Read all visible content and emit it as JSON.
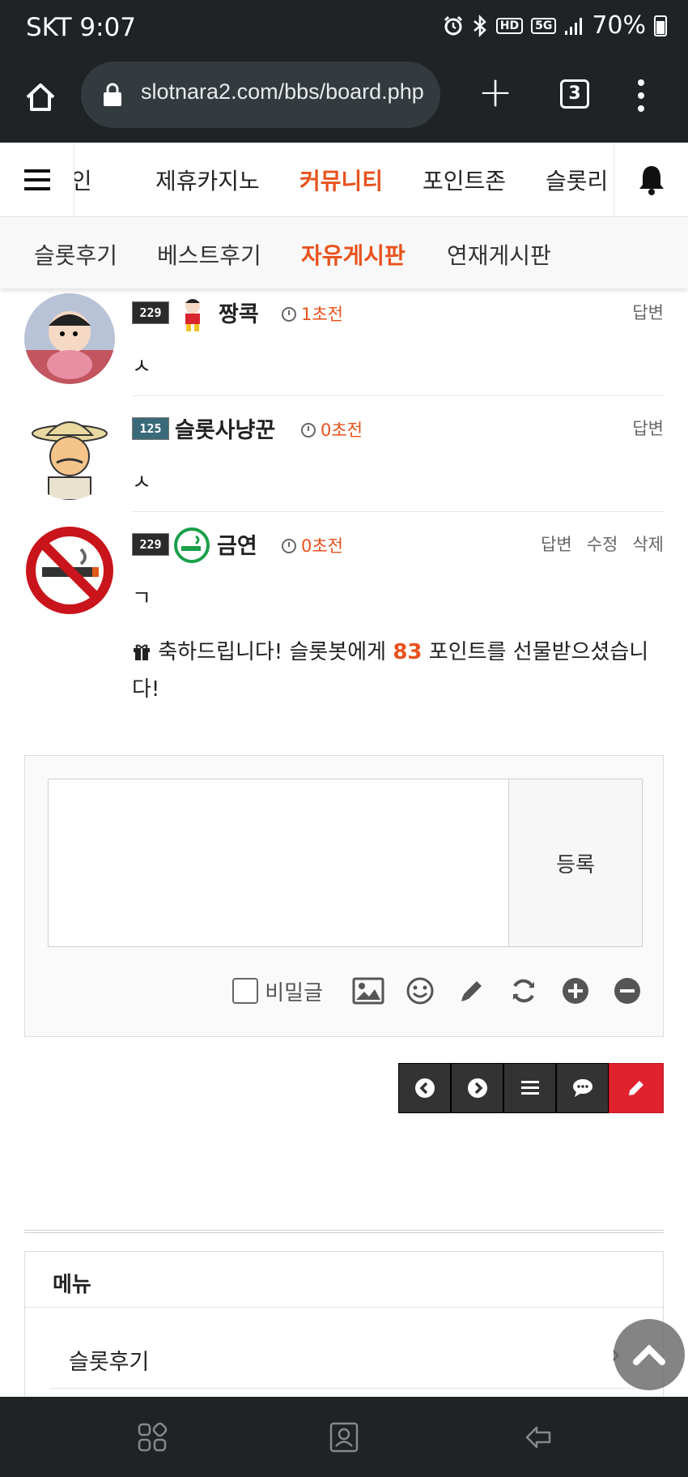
{
  "status": {
    "carrier_time": "SKT 9:07",
    "battery": "70%",
    "hd_label": "HD",
    "fiveg_label": "5G"
  },
  "browser": {
    "url": "slotnara2.com/bbs/board.php",
    "tab_count": "3"
  },
  "main_nav": {
    "items": [
      "메인",
      "제휴카지노",
      "커뮤니티",
      "포인트존",
      "슬롯리"
    ],
    "active": "커뮤니티"
  },
  "sub_nav": {
    "items": [
      "슬롯후기",
      "베스트후기",
      "자유게시판",
      "연재게시판"
    ],
    "active": "자유게시판"
  },
  "comments": [
    {
      "level": "229",
      "author": "짱콕",
      "time": "1초전",
      "body": "ㅅ",
      "actions": [
        "답변"
      ]
    },
    {
      "level": "125",
      "author": "슬롯사냥꾼",
      "time": "0초전",
      "body": "ㅅ",
      "actions": [
        "답변"
      ]
    },
    {
      "level": "229",
      "author": "금연",
      "time": "0초전",
      "body": "ㄱ",
      "actions": [
        "답변",
        "수정",
        "삭제"
      ]
    }
  ],
  "gift": {
    "prefix": "축하드립니다! 슬롯봇에게",
    "points": "83",
    "suffix": "포인트를 선물받으셨습니다!"
  },
  "reply_form": {
    "submit_label": "등록",
    "secret_label": "비밀글",
    "textarea_value": ""
  },
  "menu_panel": {
    "title": "메뉴",
    "items": [
      "슬롯후기"
    ]
  },
  "colors": {
    "accent": "#e8521d",
    "write_button": "#e0222e",
    "dark_bar": "#1f2326"
  }
}
